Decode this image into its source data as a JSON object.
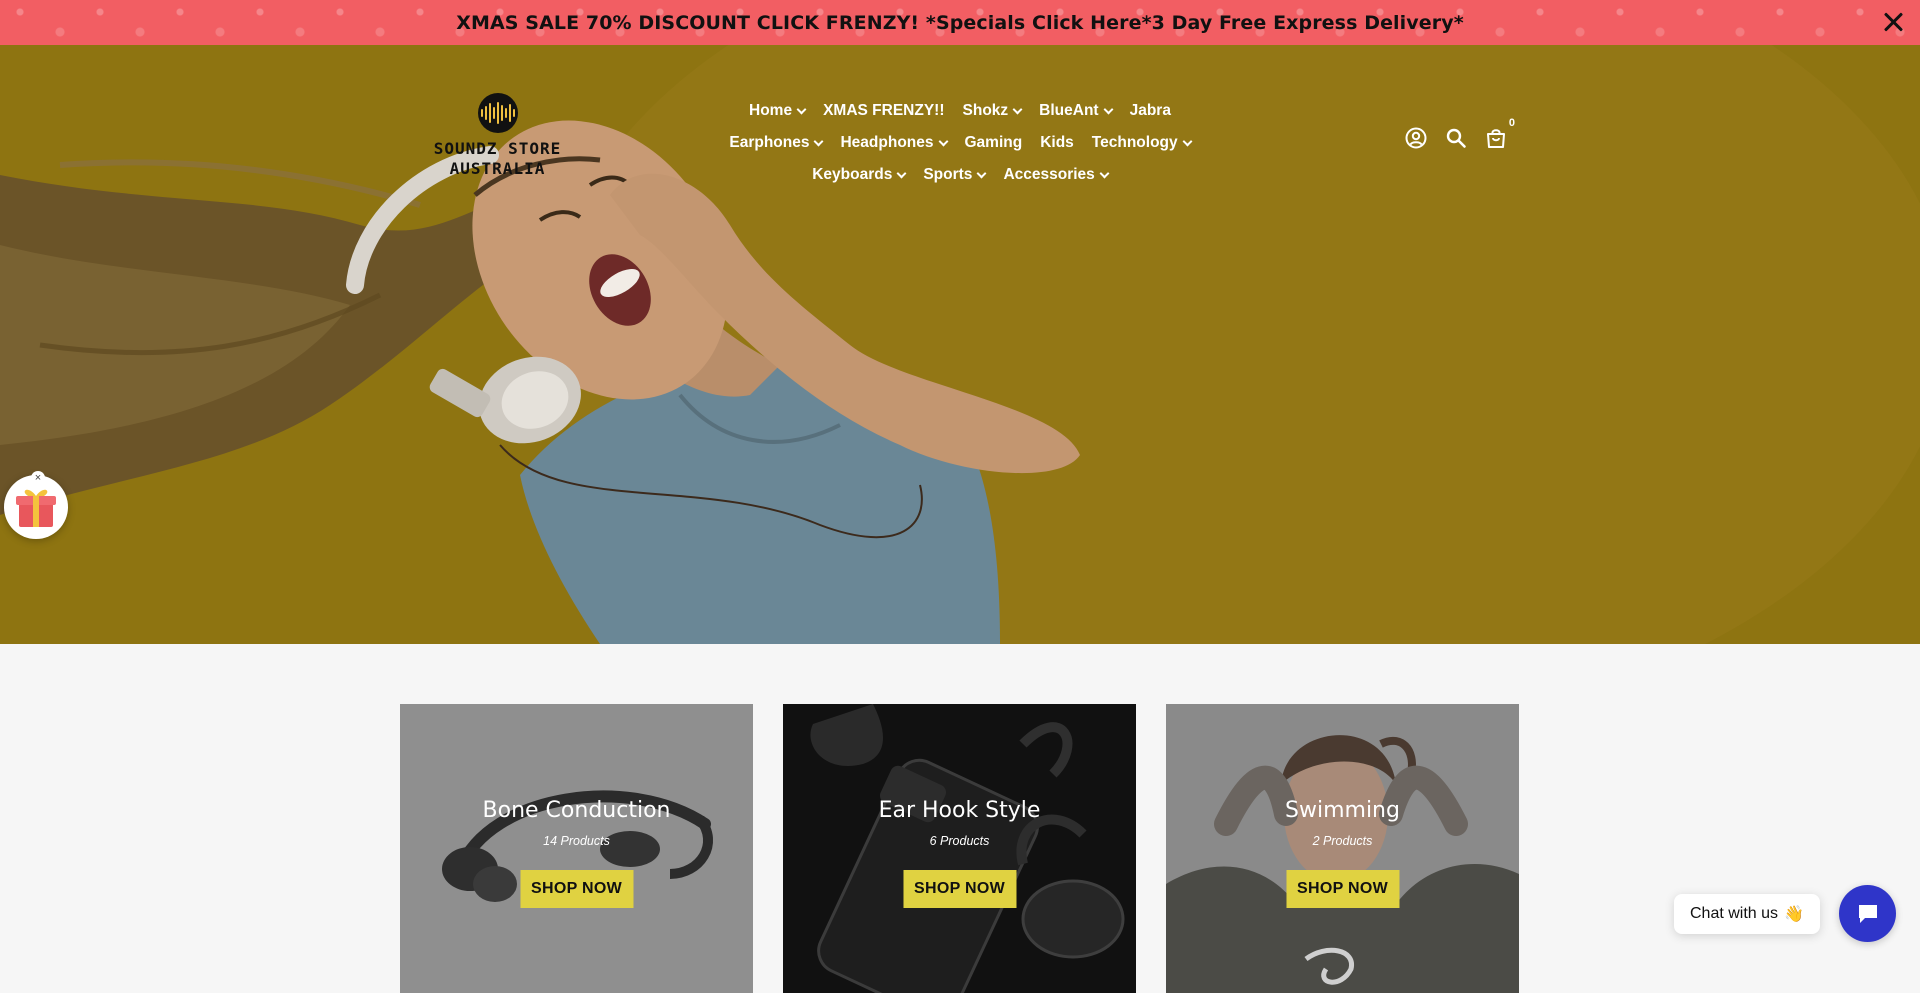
{
  "announcement": {
    "text": "XMAS SALE 70% DISCOUNT CLICK FRENZY! *Specials Click Here*3 Day Free Express Delivery*",
    "close_icon": "close-icon"
  },
  "logo": {
    "line1": "SOUNDZ STORE",
    "line2": "AUSTRALIA"
  },
  "nav": {
    "row1": [
      {
        "label": "Home",
        "dropdown": true
      },
      {
        "label": "XMAS FRENZY!!",
        "dropdown": false
      },
      {
        "label": "Shokz",
        "dropdown": true
      },
      {
        "label": "BlueAnt",
        "dropdown": true
      },
      {
        "label": "Jabra",
        "dropdown": false
      }
    ],
    "row2": [
      {
        "label": "Earphones",
        "dropdown": true
      },
      {
        "label": "Headphones",
        "dropdown": true
      },
      {
        "label": "Gaming",
        "dropdown": false
      },
      {
        "label": "Kids",
        "dropdown": false
      },
      {
        "label": "Technology",
        "dropdown": true
      }
    ],
    "row3": [
      {
        "label": "Keyboards",
        "dropdown": true
      },
      {
        "label": "Sports",
        "dropdown": true
      },
      {
        "label": "Accessories",
        "dropdown": true
      }
    ]
  },
  "header_icons": {
    "account": "account-icon",
    "search": "search-icon",
    "cart": "cart-icon",
    "cart_count": "0"
  },
  "slider": {
    "slide_count": 3,
    "active_index": 0
  },
  "gift_widget": {
    "close_label": "×"
  },
  "collections": [
    {
      "title": "Bone Conduction",
      "count": "14 Products",
      "button": "SHOP NOW"
    },
    {
      "title": "Ear Hook Style",
      "count": "6 Products",
      "button": "SHOP NOW"
    },
    {
      "title": "Swimming",
      "count": "2 Products",
      "button": "SHOP NOW"
    }
  ],
  "chat": {
    "label": "Chat with us",
    "emoji": "👋"
  },
  "colors": {
    "announcement_bg": "#f25e63",
    "button_bg": "#e0d241",
    "chat_bg": "#2f35c9"
  }
}
